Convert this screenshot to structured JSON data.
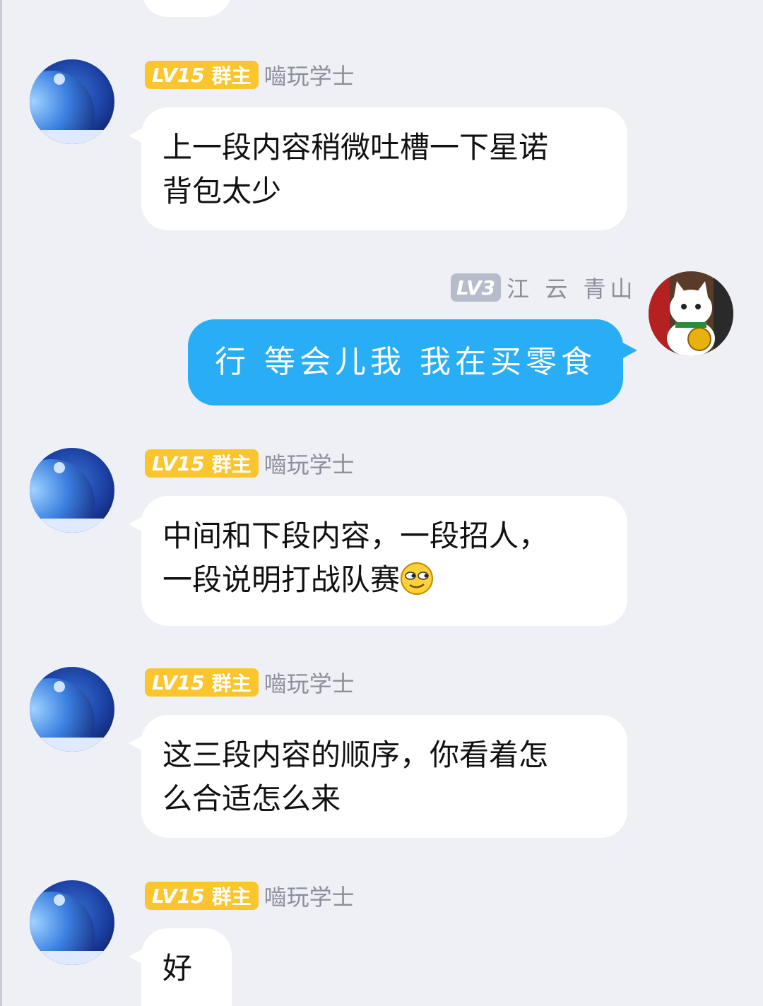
{
  "messages": [
    {
      "side": "left",
      "level": "LV15",
      "role": "群主",
      "nickname": "嚙玩学士",
      "lines": [
        "上一段内容稍微吐槽一下星诺",
        "背包太少"
      ]
    },
    {
      "side": "right",
      "level": "LV3",
      "nickname": "江 云 青山",
      "lines": [
        "行 等会儿我 我在买零食"
      ]
    },
    {
      "side": "left",
      "level": "LV15",
      "role": "群主",
      "nickname": "嚙玩学士",
      "lines": [
        "中间和下段内容，一段招人，",
        "一段说明打战队赛"
      ],
      "emoji": "smirk-emoji"
    },
    {
      "side": "left",
      "level": "LV15",
      "role": "群主",
      "nickname": "嚙玩学士",
      "lines": [
        "这三段内容的顺序，你看着怎",
        "么合适怎么来"
      ]
    },
    {
      "side": "left",
      "level": "LV15",
      "role": "群主",
      "nickname": "嚙玩学士",
      "lines": [
        "好"
      ]
    }
  ],
  "colors": {
    "background": "#eef0f6",
    "owner_badge": "#fbc52d",
    "member_badge": "#b7bccb",
    "self_bubble": "#29aef5",
    "other_bubble": "#ffffff"
  }
}
